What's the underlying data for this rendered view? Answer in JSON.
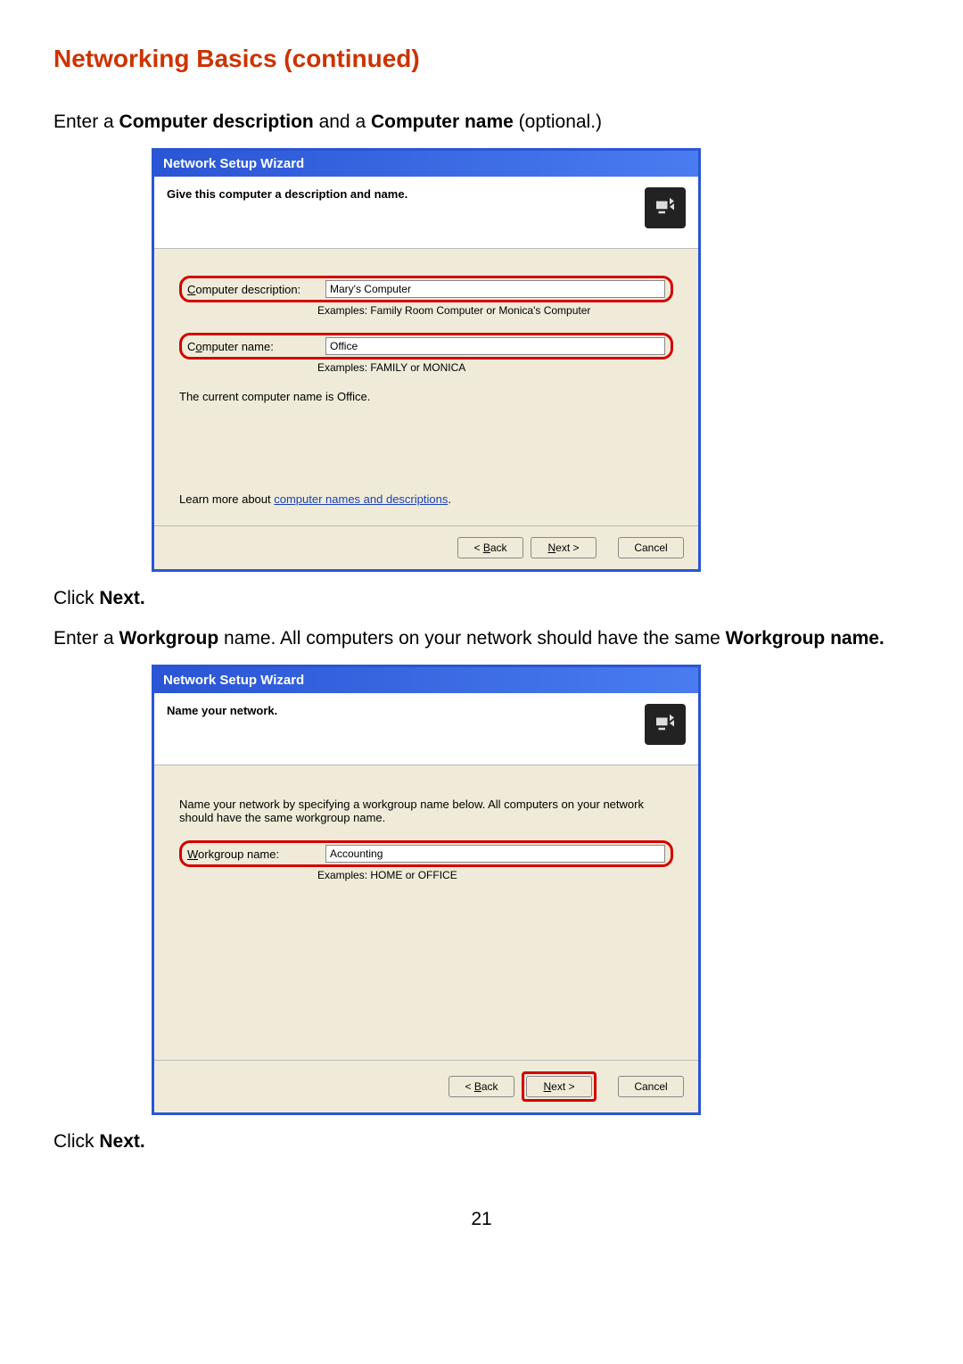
{
  "page": {
    "title": "Networking Basics (continued)",
    "number": "21"
  },
  "instr1": {
    "pre": "Enter a ",
    "b1": "Computer description",
    "mid": " and a ",
    "b2": "Computer name",
    "post": " (optional.)"
  },
  "wiz1": {
    "title": "Network Setup Wizard",
    "heading": "Give this computer a description and name.",
    "desc_label_pre": "C",
    "desc_label_u": "",
    "desc_label": "omputer description:",
    "desc_value": "Mary's Computer",
    "desc_example": "Examples: Family Room Computer or Monica's Computer",
    "name_label_pre": "C",
    "name_label_u": "o",
    "name_label_post": "mputer name:",
    "name_value": "Office",
    "name_example": "Examples: FAMILY or MONICA",
    "current": "The current computer name is Office.",
    "learn_pre": "Learn more about ",
    "learn_link": "computer names and descriptions",
    "learn_post": ".",
    "back": "< Back",
    "next": "Next >",
    "cancel": "Cancel"
  },
  "instr2": {
    "pre": "Click ",
    "b": "Next."
  },
  "instr3": {
    "pre": "Enter a ",
    "b1": "Workgroup",
    "mid": " name.  All computers on your network should have the same ",
    "b2": "Workgroup name."
  },
  "wiz2": {
    "title": "Network Setup Wizard",
    "heading": "Name your network.",
    "intro": "Name your network by specifying a workgroup name below. All computers on your network should have the same workgroup name.",
    "wg_label_u": "W",
    "wg_label_post": "orkgroup name:",
    "wg_value": "Accounting",
    "wg_example": "Examples: HOME or OFFICE",
    "back": "< Back",
    "next": "Next >",
    "cancel": "Cancel"
  },
  "instr4": {
    "pre": "Click ",
    "b": "Next."
  }
}
